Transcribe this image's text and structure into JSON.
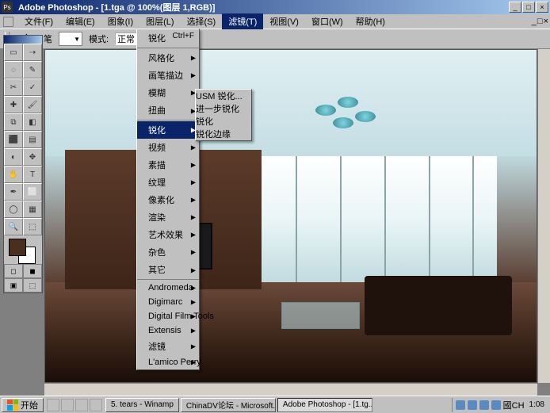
{
  "titlebar": {
    "app_title": "Adobe Photoshop - [1.tga @ 100%(图层 1,RGB)]",
    "minimize": "_",
    "maximize": "□",
    "close": "×"
  },
  "menubar": {
    "items": [
      "文件(F)",
      "编辑(E)",
      "图象(I)",
      "图层(L)",
      "选择(S)",
      "滤镜(T)",
      "视图(V)",
      "窗口(W)",
      "帮助(H)"
    ],
    "open_index": 5
  },
  "optbar": {
    "brush_label": "画笔",
    "mode_label": "模式:",
    "mode_value": "正常"
  },
  "filter_menu": {
    "items": [
      {
        "label": "锐化",
        "shortcut": "Ctrl+F",
        "sep": true
      },
      {
        "label": "风格化",
        "sub": true
      },
      {
        "label": "画笔描边",
        "sub": true
      },
      {
        "label": "模糊",
        "sub": true
      },
      {
        "label": "扭曲",
        "sub": true,
        "sep": true
      },
      {
        "label": "锐化",
        "sub": true,
        "sel": true
      },
      {
        "label": "视频",
        "sub": true
      },
      {
        "label": "素描",
        "sub": true
      },
      {
        "label": "纹理",
        "sub": true
      },
      {
        "label": "像素化",
        "sub": true
      },
      {
        "label": "渲染",
        "sub": true
      },
      {
        "label": "艺术效果",
        "sub": true
      },
      {
        "label": "杂色",
        "sub": true
      },
      {
        "label": "其它",
        "sub": true,
        "sep": true
      },
      {
        "label": "Andromeda",
        "sub": true
      },
      {
        "label": "Digimarc",
        "sub": true
      },
      {
        "label": "Digital Film Tools",
        "sub": true
      },
      {
        "label": "Extensis",
        "sub": true
      },
      {
        "label": "滤镜",
        "sub": true
      },
      {
        "label": "L'amico Perry",
        "sub": true
      }
    ]
  },
  "sharpen_submenu": {
    "items": [
      {
        "label": "USM 锐化...",
        "sel": false
      },
      {
        "label": "进一步锐化",
        "sel": false
      },
      {
        "label": "锐化",
        "sel": true
      },
      {
        "label": "锐化边缘",
        "sel": false
      }
    ]
  },
  "toolbox": {
    "tools": [
      "▭",
      "⇢",
      "◌",
      "✎",
      "✂",
      "✓",
      "✚",
      "🖌",
      "⧉",
      "◧",
      "⬛",
      "▤",
      "◐",
      "✥",
      "✋",
      "T",
      "✒",
      "⬜",
      "◯",
      "▦",
      "🔍",
      "⬚"
    ],
    "mini": [
      "◻",
      "◼",
      "▣",
      "⬚"
    ]
  },
  "taskbar": {
    "start": "开始",
    "tasks": [
      {
        "label": "5. tears - Winamp",
        "active": false
      },
      {
        "label": "ChinaDV论坛 - Microsoft...",
        "active": false
      },
      {
        "label": "Adobe Photoshop - [1.tg...",
        "active": true
      }
    ],
    "ime": "國CH",
    "clock": "1:08"
  }
}
